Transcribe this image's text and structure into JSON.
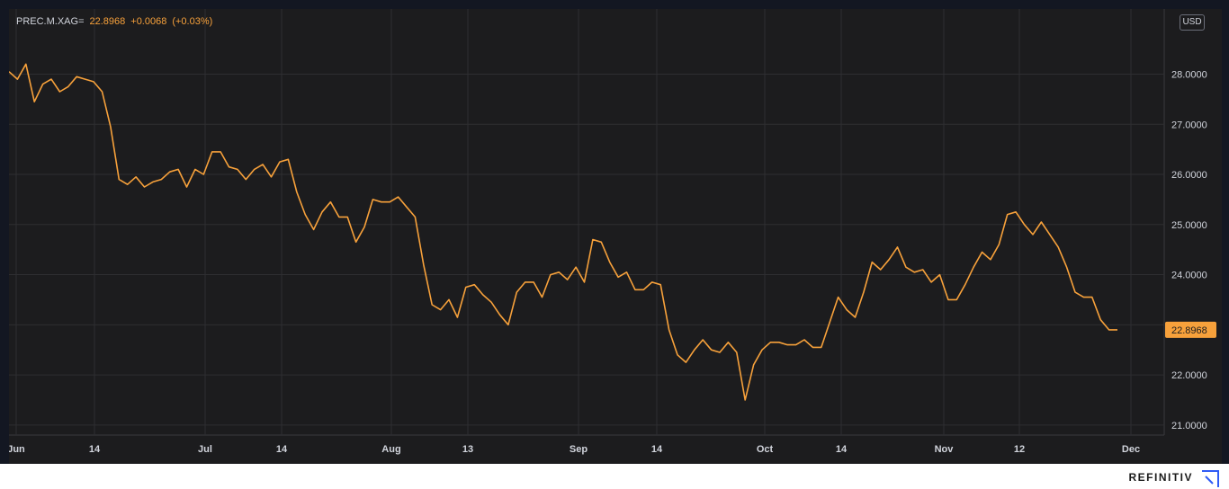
{
  "legend": {
    "symbol": "PREC.M.XAG=",
    "last": "22.8968",
    "change": "+0.0068",
    "change_pct": "(+0.03%)"
  },
  "currency": "USD",
  "brand": "REFINITIV",
  "colors": {
    "background": "#1c1c1e",
    "line": "#f7a13b",
    "grid": "#2e2e31",
    "text": "#d1d4dc",
    "price_tag": "#f7a13b"
  },
  "chart_data": {
    "type": "line",
    "title": "",
    "xlabel": "",
    "ylabel": "",
    "ylim": [
      20.8,
      29.3
    ],
    "y_ticks": [
      "21.0000",
      "22.0000",
      "23.0000",
      "24.0000",
      "25.0000",
      "26.0000",
      "27.0000",
      "28.0000"
    ],
    "x_ticks": [
      "Jun",
      "14",
      "Jul",
      "14",
      "Aug",
      "13",
      "Sep",
      "14",
      "Oct",
      "14",
      "Nov",
      "12",
      "Dec"
    ],
    "last_price_label": "22.8968",
    "grid": true,
    "series": [
      {
        "values": [
          28.05,
          27.9,
          28.2,
          27.45,
          27.8,
          27.9,
          27.65,
          27.75,
          27.95,
          27.9,
          27.85,
          27.65,
          26.95,
          25.9,
          25.8,
          25.95,
          25.75,
          25.85,
          25.9,
          26.05,
          26.1,
          25.75,
          26.1,
          26.0,
          26.45,
          26.45,
          26.15,
          26.1,
          25.9,
          26.1,
          26.2,
          25.95,
          26.25,
          26.3,
          25.65,
          25.2,
          24.9,
          25.25,
          25.45,
          25.15,
          25.15,
          24.65,
          24.95,
          25.5,
          25.45,
          25.45,
          25.55,
          25.35,
          25.15,
          24.2,
          23.4,
          23.3,
          23.5,
          23.15,
          23.75,
          23.8,
          23.6,
          23.45,
          23.2,
          23.0,
          23.65,
          23.85,
          23.85,
          23.55,
          24.0,
          24.05,
          23.9,
          24.15,
          23.85,
          24.7,
          24.65,
          24.25,
          23.95,
          24.05,
          23.7,
          23.7,
          23.85,
          23.8,
          22.9,
          22.4,
          22.25,
          22.5,
          22.7,
          22.5,
          22.45,
          22.65,
          22.45,
          21.5,
          22.2,
          22.5,
          22.65,
          22.65,
          22.6,
          22.6,
          22.7,
          22.55,
          22.55,
          23.05,
          23.55,
          23.3,
          23.15,
          23.65,
          24.25,
          24.1,
          24.3,
          24.55,
          24.15,
          24.05,
          24.1,
          23.85,
          24.0,
          23.5,
          23.5,
          23.8,
          24.15,
          24.45,
          24.3,
          24.6,
          25.2,
          25.25,
          25.0,
          24.8,
          25.05,
          24.8,
          24.55,
          24.15,
          23.65,
          23.55,
          23.55,
          23.1,
          22.9,
          22.9
        ]
      }
    ]
  }
}
